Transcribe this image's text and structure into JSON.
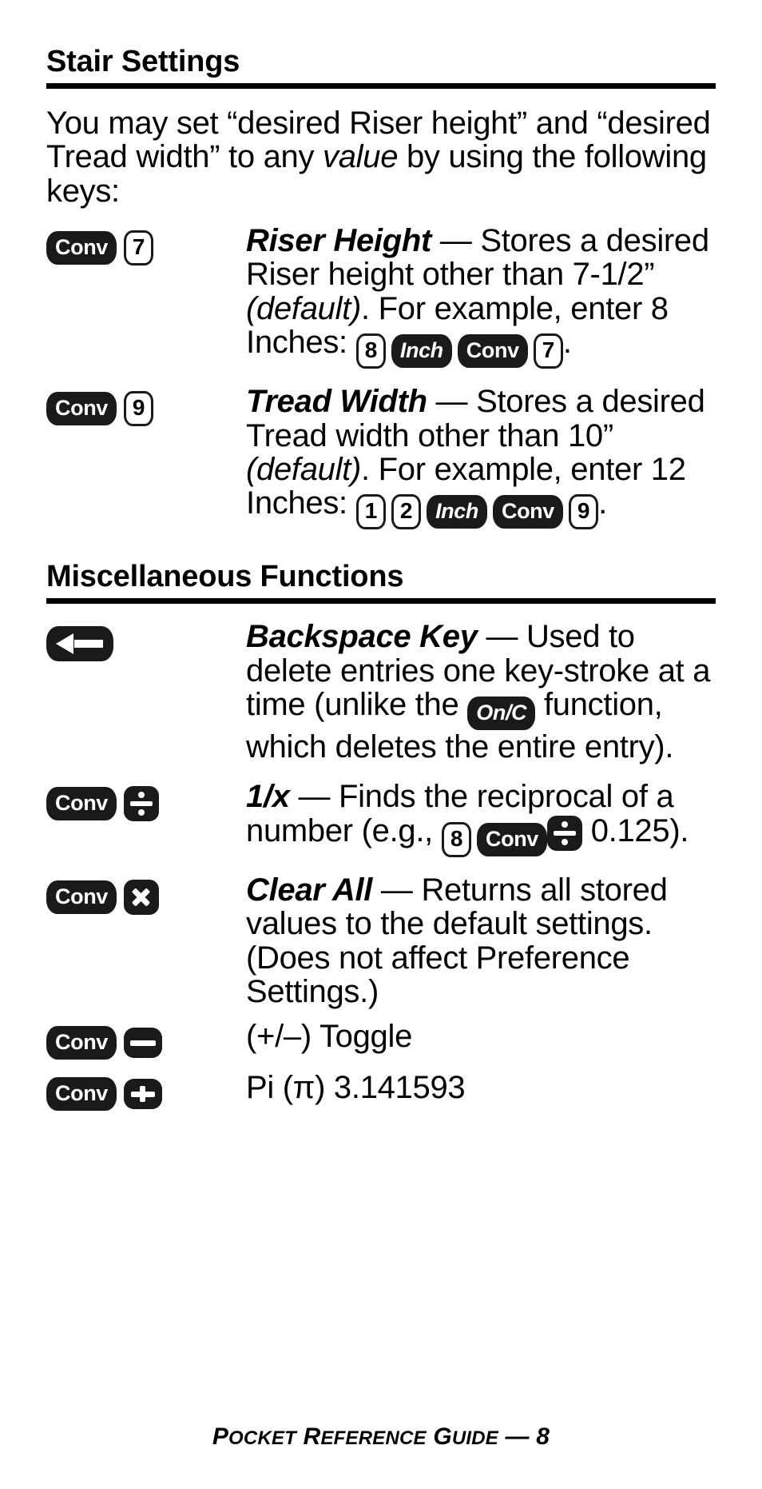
{
  "document": {
    "footer_text": "Pocket Reference Guide — 8",
    "footer_parts": {
      "p1": "P",
      "p2": "OCKET",
      "p3": "R",
      "p4": "EFERENCE",
      "p5": "G",
      "p6": "UIDE",
      "p7": "— 8"
    }
  },
  "sections": [
    {
      "id": "stair-settings",
      "heading": "Stair Settings",
      "intro": {
        "part1": "You may set “desired Riser height” and “desired Tread width” to any ",
        "emphasis": "value",
        "part2": " by using the following keys:"
      },
      "entries": [
        {
          "id": "riser-height",
          "keys": [
            {
              "type": "dark",
              "label": "Conv",
              "name": "conv-key"
            },
            {
              "type": "light",
              "label": "7",
              "name": "digit-7-key"
            }
          ],
          "term": "Riser Height",
          "dash": " — ",
          "text1": "Stores a desired Riser height other than 7-1/2” ",
          "italic": "(default)",
          "text2": ". For example, enter 8 Inches: ",
          "inline_keys": [
            {
              "type": "light",
              "label": "8",
              "name": "digit-8-key"
            },
            {
              "type": "dark-italic",
              "label": "Inch",
              "name": "inch-key"
            },
            {
              "type": "dark",
              "label": "Conv",
              "name": "conv-key"
            },
            {
              "type": "light",
              "label": "7",
              "name": "digit-7-key"
            }
          ],
          "text_after": "."
        },
        {
          "id": "tread-width",
          "keys": [
            {
              "type": "dark",
              "label": "Conv",
              "name": "conv-key"
            },
            {
              "type": "light",
              "label": "9",
              "name": "digit-9-key"
            }
          ],
          "term": "Tread Width",
          "dash": " — ",
          "text1": "Stores a desired Tread width other than 10” ",
          "italic": "(default)",
          "text2": ". For example, enter 12 Inches: ",
          "inline_keys": [
            {
              "type": "light",
              "label": "1",
              "name": "digit-1-key"
            },
            {
              "type": "light",
              "label": "2",
              "name": "digit-2-key"
            },
            {
              "type": "dark-italic",
              "label": "Inch",
              "name": "inch-key"
            },
            {
              "type": "dark",
              "label": "Conv",
              "name": "conv-key"
            },
            {
              "type": "light",
              "label": "9",
              "name": "digit-9-key"
            }
          ],
          "text_after": "."
        }
      ]
    },
    {
      "id": "miscellaneous-functions",
      "heading": "Miscellaneous Functions",
      "entries": [
        {
          "id": "backspace-key",
          "term": "Backspace Key",
          "dash": " — ",
          "text1": "Used to delete entries one key-stroke at a time (unlike the ",
          "inline_key_label": "On/C",
          "text2": " function, which deletes the entire entry)."
        },
        {
          "id": "reciprocal",
          "term": "1/x",
          "dash": " — ",
          "text1": "Finds the reciprocal of a number (e.g., ",
          "text2": " 0.125).",
          "keys": [
            {
              "type": "dark",
              "label": "Conv",
              "name": "conv-key"
            },
            {
              "type": "symbol",
              "label": "÷",
              "name": "divide-key"
            }
          ],
          "inline_keys": [
            {
              "type": "light",
              "label": "8",
              "name": "digit-8-key"
            },
            {
              "type": "dark",
              "label": "Conv",
              "name": "conv-key"
            }
          ]
        },
        {
          "id": "clear-all",
          "term": "Clear All",
          "dash": " — ",
          "text1": "Returns all stored values to the default settings. (Does not affect Preference Settings.)",
          "keys": [
            {
              "type": "dark",
              "label": "Conv",
              "name": "conv-key"
            },
            {
              "type": "symbol",
              "label": "×",
              "name": "multiply-key"
            }
          ]
        },
        {
          "id": "plus-minus-toggle",
          "text1": "(+/–) Toggle",
          "keys": [
            {
              "type": "dark",
              "label": "Conv",
              "name": "conv-key"
            },
            {
              "type": "symbol",
              "label": "−",
              "name": "minus-key"
            }
          ]
        },
        {
          "id": "pi",
          "text1": "Pi (π) 3.141593",
          "keys": [
            {
              "type": "dark",
              "label": "Conv",
              "name": "conv-key"
            },
            {
              "type": "symbol",
              "label": "+",
              "name": "plus-key"
            }
          ]
        }
      ]
    }
  ]
}
